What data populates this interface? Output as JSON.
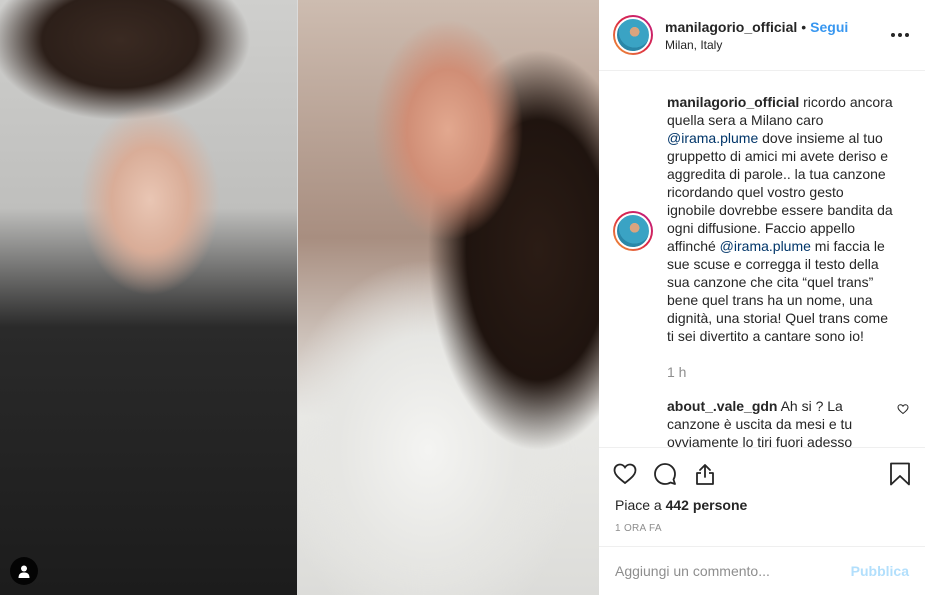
{
  "post": {
    "author": "manilagorio_official",
    "follow_label": "Segui",
    "separator": "•",
    "location": "Milan, Italy"
  },
  "caption": {
    "username": "manilagorio_official",
    "text_1": " ricordo ancora quella sera a Milano caro ",
    "mention_1": "@irama.plume",
    "text_2": " dove insieme al tuo gruppetto di amici mi avete deriso e aggredita di parole.. la tua canzone ricordando quel vostro gesto ignobile dovrebbe essere bandita da ogni diffusione. Faccio appello affinché ",
    "mention_2": "@irama.plume",
    "text_3": " mi faccia le sue scuse e corregga il testo della sua canzone che cita “quel trans” bene quel trans ha un nome, una dignità, una storia! Quel trans come ti sei divertito a cantare sono io!",
    "time": "1 h"
  },
  "reply": {
    "username": "about_.vale_gdn",
    "text": " Ah si ? La canzone è uscita da mesi e tu ovviamente lo tiri fuori adesso"
  },
  "actions": {
    "likes_prefix": "Piace a ",
    "likes_count": "442",
    "likes_suffix": " persone",
    "time_ago": "1 ORA FA"
  },
  "comment_box": {
    "placeholder": "Aggiungi un commento...",
    "publish_label": "Pubblica"
  },
  "icons": {
    "more": "more-horizontal-icon",
    "heart": "heart-icon",
    "comment": "comment-icon",
    "share": "share-icon",
    "bookmark": "bookmark-icon",
    "user_tag": "user-icon"
  },
  "colors": {
    "link": "#3897f0",
    "mention": "#003569",
    "muted": "#8e8e8e",
    "publish_disabled": "#b2dffc"
  }
}
